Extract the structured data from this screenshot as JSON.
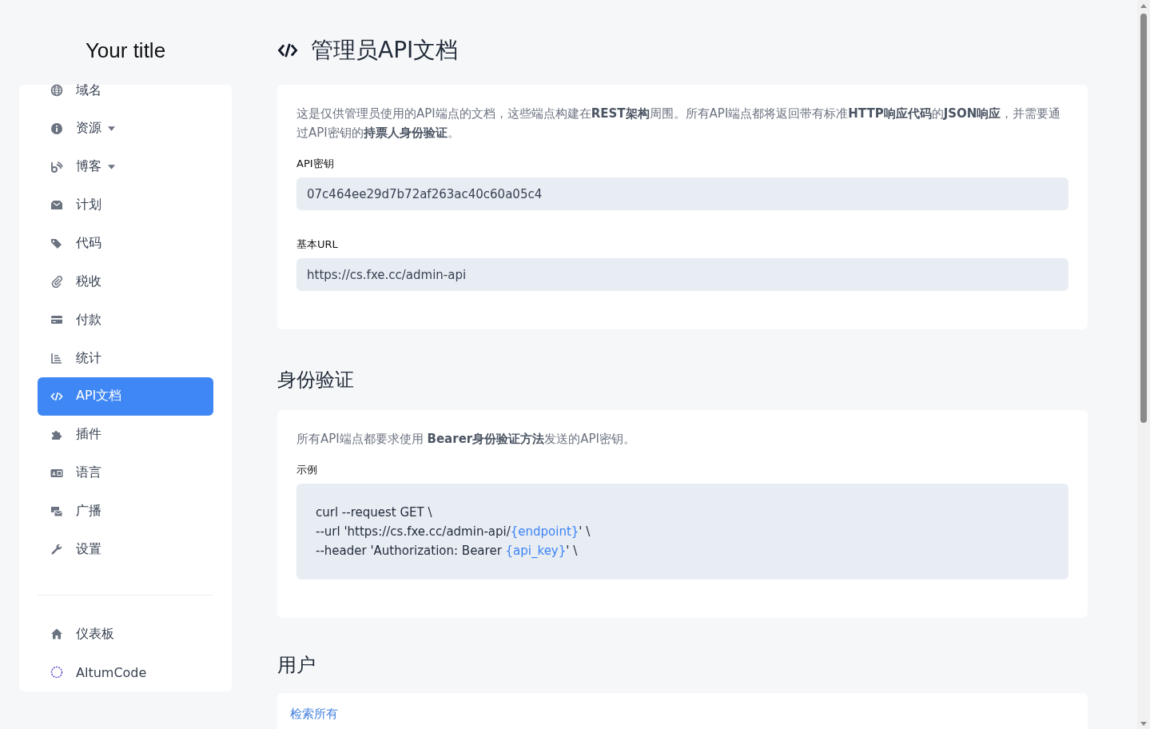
{
  "sidebar": {
    "title": "Your title",
    "items": [
      {
        "label": "域名",
        "dropdown": false,
        "selected": false
      },
      {
        "label": "资源",
        "dropdown": true,
        "selected": false
      },
      {
        "label": "博客",
        "dropdown": true,
        "selected": false
      },
      {
        "label": "计划",
        "dropdown": false,
        "selected": false
      },
      {
        "label": "代码",
        "dropdown": false,
        "selected": false
      },
      {
        "label": "税收",
        "dropdown": false,
        "selected": false
      },
      {
        "label": "付款",
        "dropdown": false,
        "selected": false
      },
      {
        "label": "统计",
        "dropdown": false,
        "selected": false
      },
      {
        "label": "API文档",
        "dropdown": false,
        "selected": true
      },
      {
        "label": "插件",
        "dropdown": false,
        "selected": false
      },
      {
        "label": "语言",
        "dropdown": false,
        "selected": false
      },
      {
        "label": "广播",
        "dropdown": false,
        "selected": false
      },
      {
        "label": "设置",
        "dropdown": false,
        "selected": false
      }
    ],
    "footer_items": [
      {
        "label": "仪表板"
      },
      {
        "label": "AltumCode"
      }
    ]
  },
  "page": {
    "title": "管理员API文档",
    "intro": "这是仅供管理员使用的API端点的文档，这些端点构建在**REST架构**周围。所有API端点都将返回带有标准**HTTP响应代码**的**JSON响应**，并需要通过API密钥的**持票人身份验证**。",
    "fields": [
      {
        "label": "API密钥",
        "value": "07c464ee29d7b72af263ac40c60a05c4"
      },
      {
        "label": "基本URL",
        "value": "https://cs.fxe.cc/admin-api"
      }
    ],
    "auth": {
      "heading": "身份验证",
      "text": "所有API端点都要求使用 **Bearer身份验证方法**发送的API密钥。",
      "example_label": "示例",
      "code_lines": [
        [
          {
            "kind": "plain",
            "text": "curl --request GET \\"
          }
        ],
        [
          {
            "kind": "plain",
            "text": "--url 'https://cs.fxe.cc/admin-api/"
          },
          {
            "kind": "placeholder",
            "text": "{endpoint}"
          },
          {
            "kind": "plain",
            "text": "' \\"
          }
        ],
        [
          {
            "kind": "plain",
            "text": "--header 'Authorization: Bearer "
          },
          {
            "kind": "placeholder",
            "text": "{api_key}"
          },
          {
            "kind": "plain",
            "text": "' \\"
          }
        ]
      ]
    },
    "users": {
      "heading": "用户",
      "link": "检索所有"
    }
  }
}
